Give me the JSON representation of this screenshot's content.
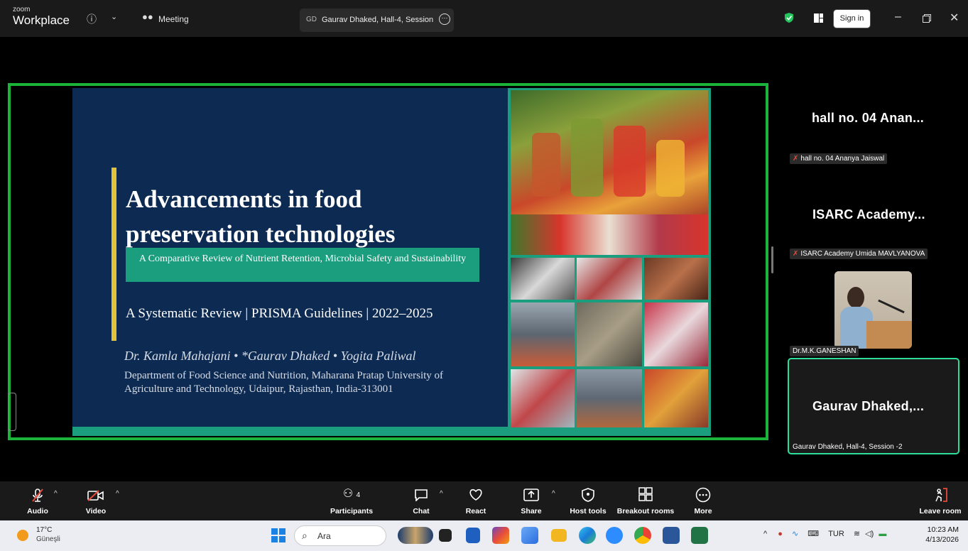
{
  "titlebar": {
    "app_small": "zoom",
    "app_name": "Workplace",
    "info_icon": "info-icon",
    "meeting_label": "Meeting",
    "speaker_initials": "GD",
    "speaker_tab": "Gaurav Dhaked, Hall-4, Session -2",
    "sign_in": "Sign in"
  },
  "slide": {
    "title": "Advancements in food preservation technologies",
    "subtitle": "A Comparative Review of Nutrient Retention, Microbial Safety and Sustainability",
    "review_line": "A Systematic Review | PRISMA Guidelines | 2022–2025",
    "authors": "Dr. Kamla Mahajani  •  *Gaurav Dhaked  •  Yogita Paliwal",
    "department": "Department of Food Science and Nutrition, Maharana Pratap University of Agriculture and Technology, Udaipur, Rajasthan, India-313001"
  },
  "participants": [
    {
      "tile_name": "hall no. 04 Anan...",
      "label": "hall no. 04 Ananya Jaiswal",
      "muted": true
    },
    {
      "tile_name": "ISARC Academy...",
      "label": "ISARC Academy Umida MAVLYANOVA",
      "muted": true
    },
    {
      "tile_name": "",
      "label": "Dr.M.K.GANESHAN",
      "muted": false
    },
    {
      "tile_name": "Gaurav Dhaked,...",
      "label": "Gaurav Dhaked, Hall-4, Session -2",
      "muted": false
    }
  ],
  "toolbar": {
    "audio": "Audio",
    "video": "Video",
    "participants": "Participants",
    "participants_count": "4",
    "chat": "Chat",
    "react": "React",
    "share": "Share",
    "host_tools": "Host tools",
    "breakout_rooms": "Breakout rooms",
    "more": "More",
    "leave_room": "Leave room"
  },
  "taskbar": {
    "temperature": "17°C",
    "condition": "Güneşli",
    "search_placeholder": "Ara",
    "language": "TUR",
    "time": "10:23 AM",
    "date": "4/13/2026"
  },
  "colors": {
    "active_speaker_border": "#1bb33a",
    "slide_background": "#0d2a52",
    "slide_accent": "#e2c33b",
    "subtitle_box": "#1a9e7d"
  }
}
